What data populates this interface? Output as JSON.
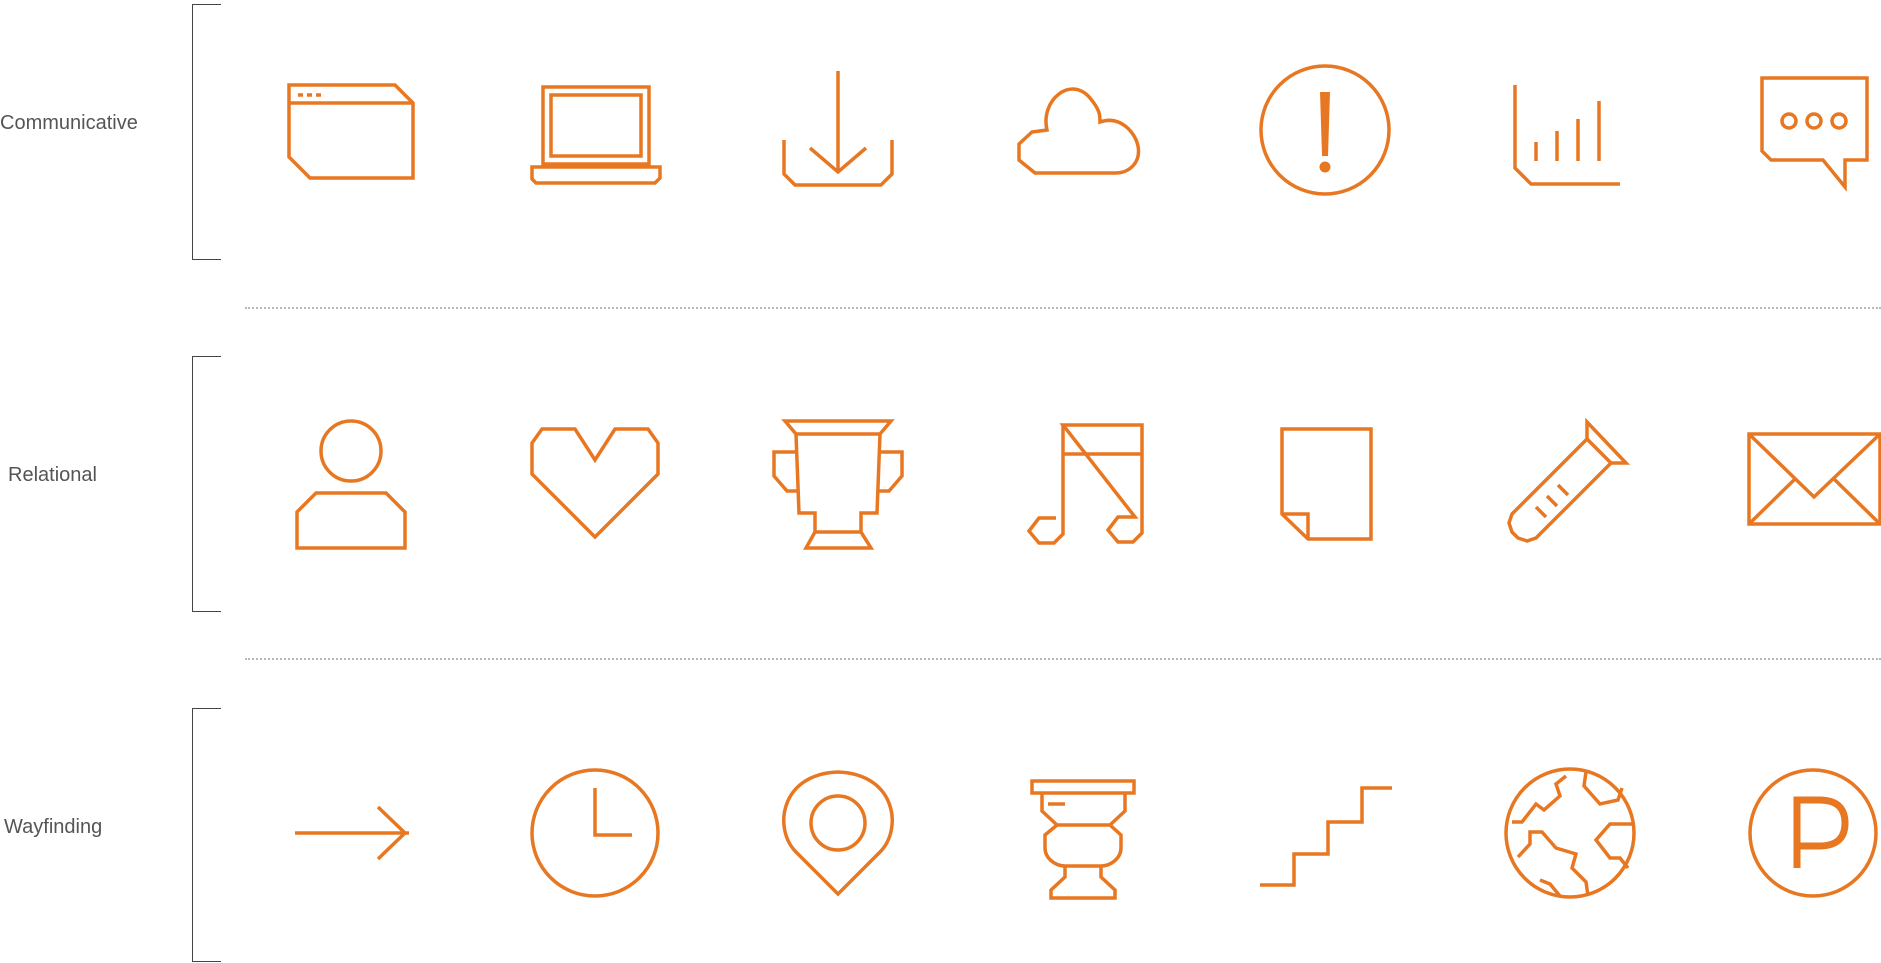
{
  "colors": {
    "accent": "#e87722",
    "label": "#555555",
    "bracket": "#444444",
    "divider": "#b8b8b8"
  },
  "rows": [
    {
      "label": "Communicative",
      "icons": [
        "browser-window-icon",
        "laptop-icon",
        "download-icon",
        "cloud-icon",
        "alert-icon",
        "bar-chart-icon",
        "chat-bubble-icon"
      ]
    },
    {
      "label": "Relational",
      "icons": [
        "user-icon",
        "heart-icon",
        "trophy-icon",
        "music-note-icon",
        "document-icon",
        "test-tube-icon",
        "envelope-icon"
      ]
    },
    {
      "label": "Wayfinding",
      "icons": [
        "arrow-right-icon",
        "clock-icon",
        "map-pin-icon",
        "toilet-icon",
        "stairs-icon",
        "globe-icon",
        "parking-icon"
      ]
    }
  ],
  "glyphs": {
    "alert": "!",
    "parking": "P"
  }
}
